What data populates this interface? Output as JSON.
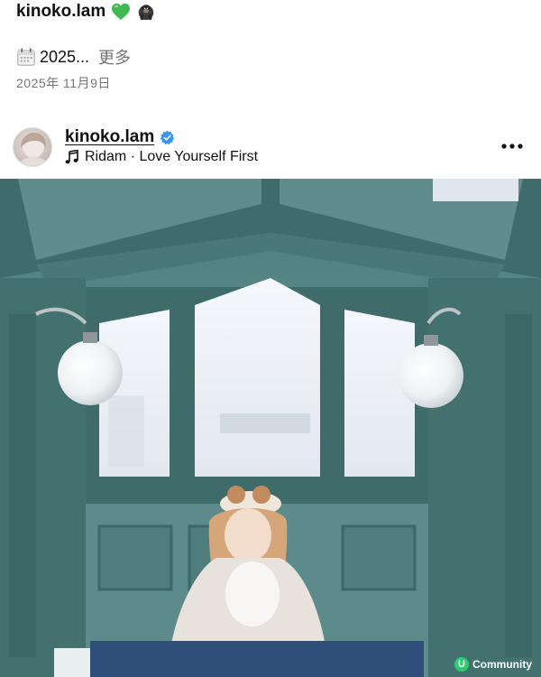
{
  "caption": {
    "username": "kinoko.lam",
    "emoji_heart": "green-heart",
    "emoji_gorilla": "gorilla",
    "body_text": "2025...",
    "more_label": "更多",
    "calendar_icon": "calendar-icon",
    "date": "2025年 11月9日"
  },
  "post": {
    "username": "kinoko.lam",
    "verified": true,
    "music_icon": "music-note-icon",
    "music_text": "Ridam · Love Yourself First",
    "more_icon": "more-horizontal-icon"
  },
  "photo": {
    "watermark_text": "Community",
    "watermark_badge": "U"
  },
  "colors": {
    "verified_blue": "#3897f0",
    "heart_green": "#3fb950",
    "secondary_text": "#737373"
  }
}
